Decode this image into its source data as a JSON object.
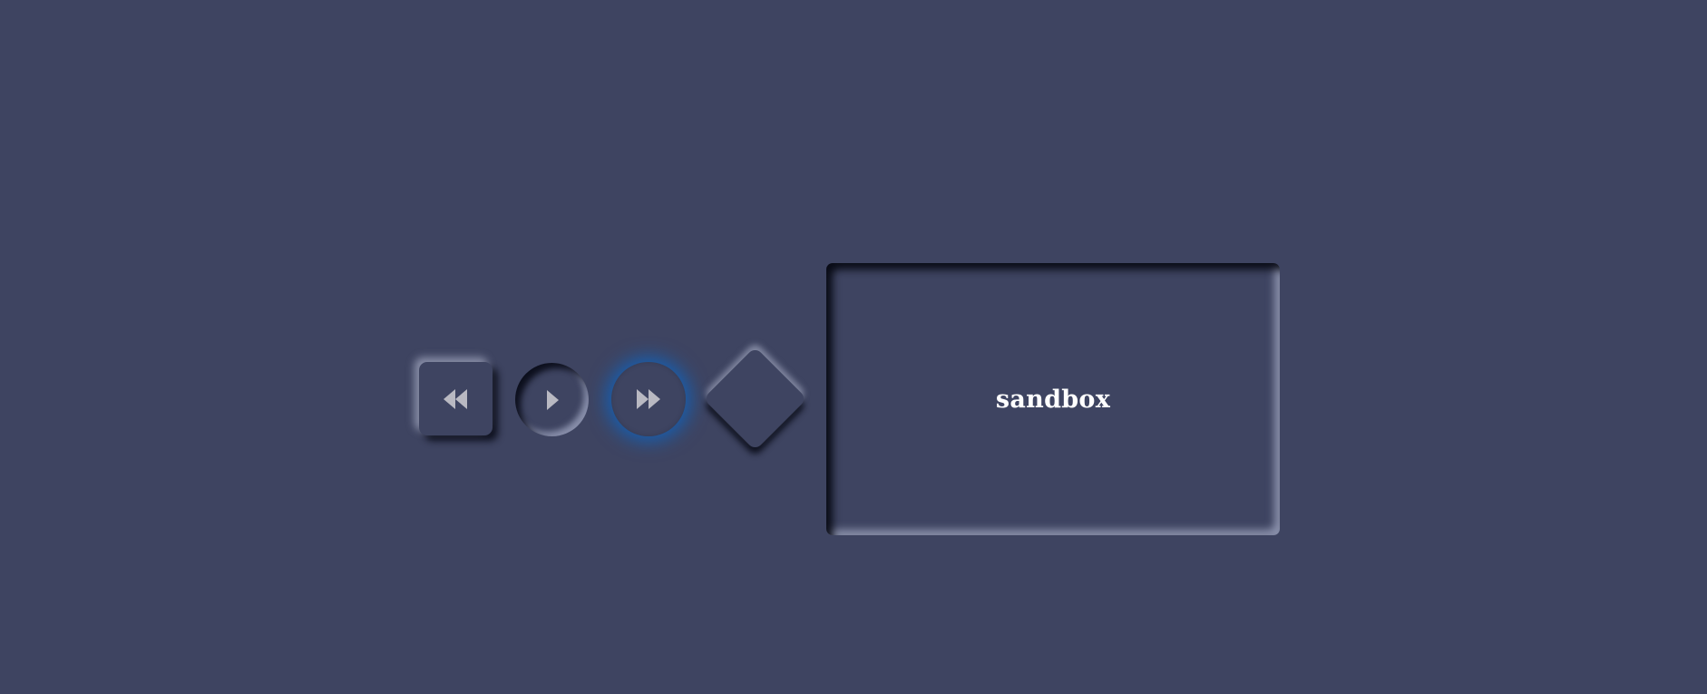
{
  "controls": {
    "rewind": {
      "icon": "rewind-icon"
    },
    "play": {
      "icon": "play-icon"
    },
    "fast_forward": {
      "icon": "fast-forward-icon"
    },
    "diamond": {
      "icon": ""
    }
  },
  "sandbox": {
    "label": "sandbox"
  },
  "colors": {
    "background": "#3e4461",
    "icon": "#b9b9c2",
    "glow": "#0a6fd6",
    "label": "#ffffff"
  }
}
